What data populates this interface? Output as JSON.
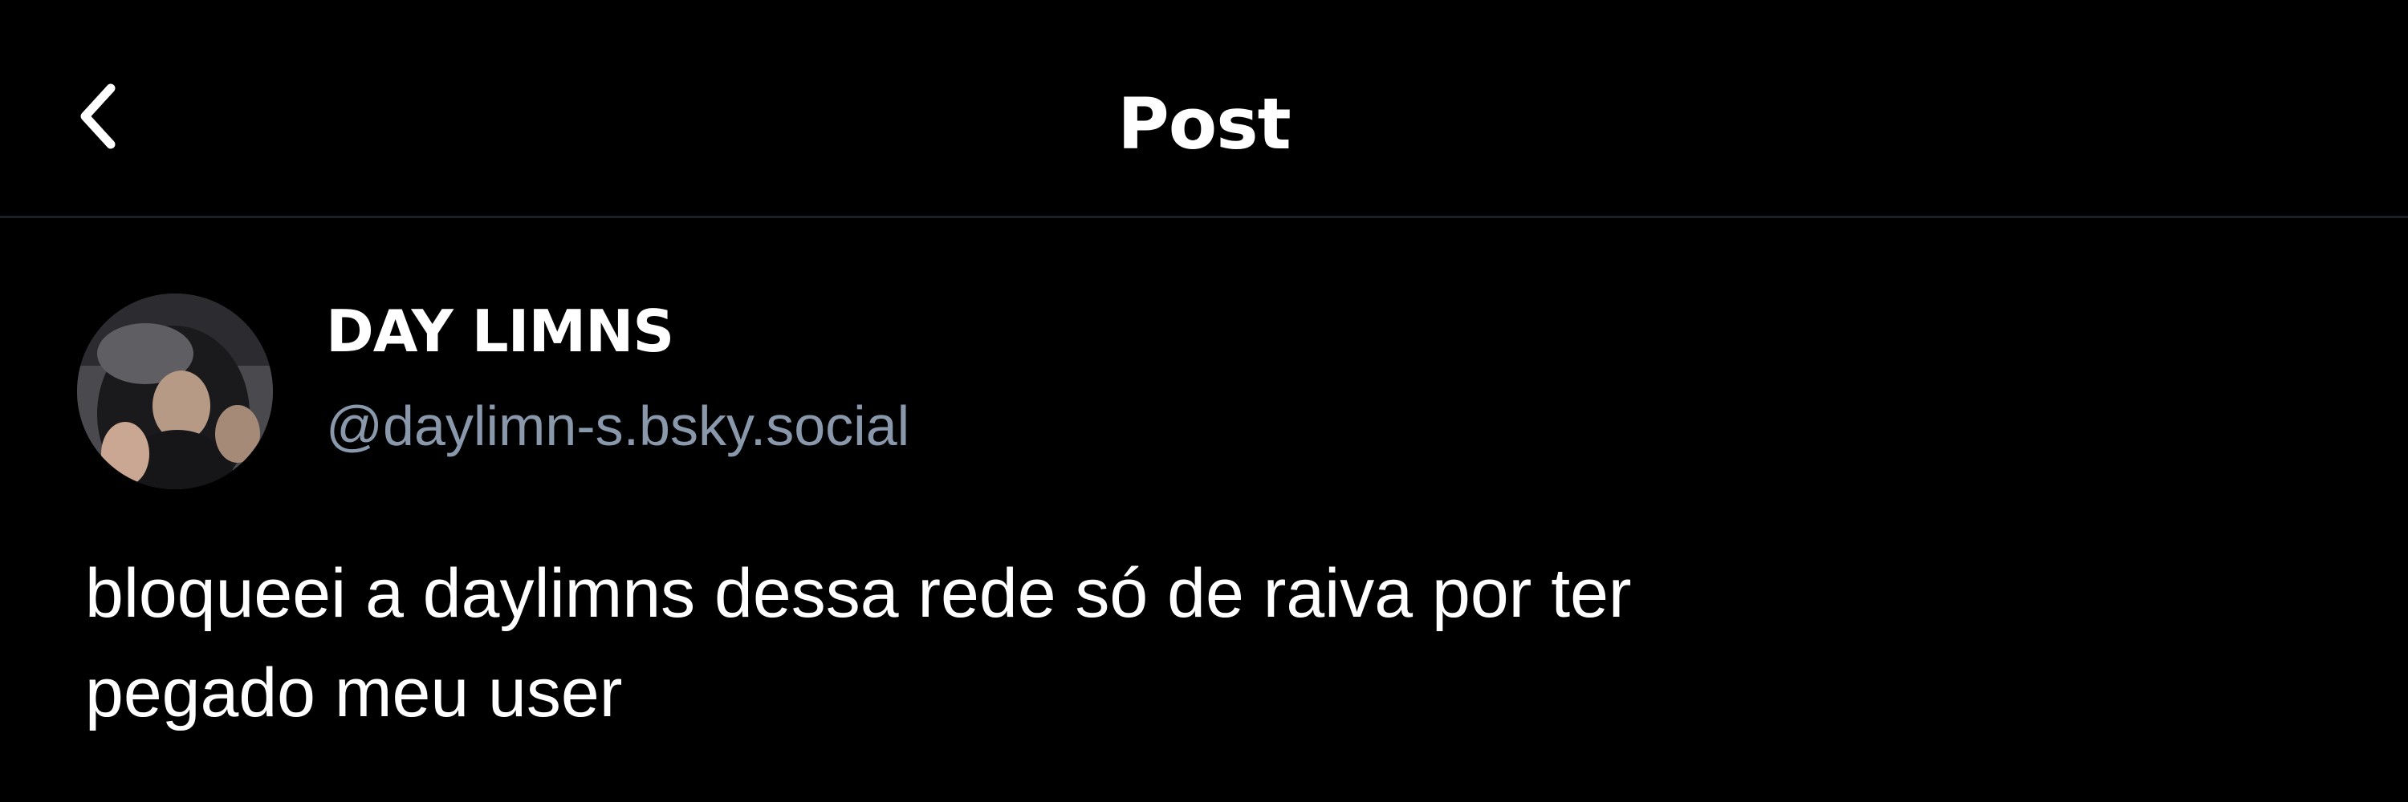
{
  "header": {
    "title": "Post",
    "back_icon": "chevron-left-icon"
  },
  "post": {
    "author": {
      "display_name": "DAY LIMNS",
      "handle": "@daylimn-s.bsky.social",
      "avatar": "avatar-photo"
    },
    "text": "bloqueei a daylimns dessa rede só de raiva por ter\npegado meu user"
  },
  "colors": {
    "background": "#000000",
    "primary_text": "#ffffff",
    "handle_text": "#8a98ac",
    "divider": "#1c1f26"
  }
}
